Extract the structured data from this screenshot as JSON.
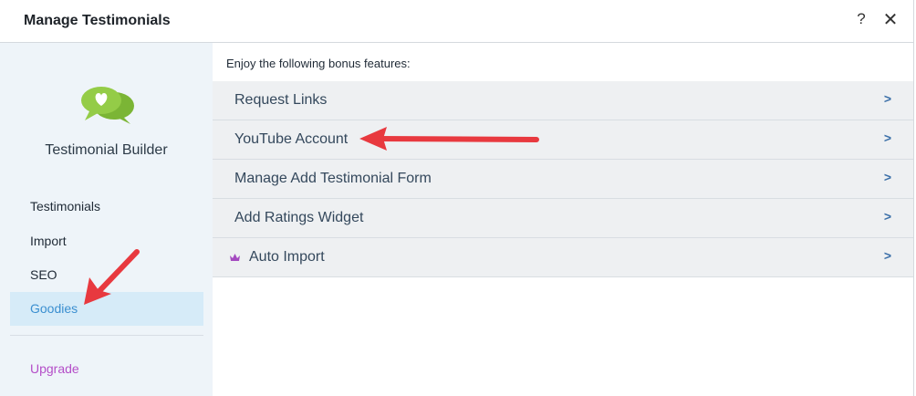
{
  "dialog": {
    "title": "Manage Testimonials",
    "help_label": "?",
    "close_label": "✕"
  },
  "sidebar": {
    "app_name": "Testimonial Builder",
    "items": [
      {
        "label": "Testimonials",
        "active": false
      },
      {
        "label": "Import",
        "active": false
      },
      {
        "label": "SEO",
        "active": false
      },
      {
        "label": "Goodies",
        "active": true
      }
    ],
    "upgrade_label": "Upgrade"
  },
  "main": {
    "intro": "Enjoy the following bonus features:",
    "features": [
      {
        "label": "Request Links",
        "chevron": ">"
      },
      {
        "label": "YouTube Account",
        "chevron": ">"
      },
      {
        "label": "Manage Add Testimonial Form",
        "chevron": ">"
      },
      {
        "label": "Add Ratings Widget",
        "chevron": ">"
      },
      {
        "label": "Auto Import",
        "chevron": ">",
        "icon": "crown-icon"
      }
    ]
  },
  "colors": {
    "sidebar_bg": "#eef4f9",
    "active_bg": "#d6ebf8",
    "active_text": "#3b8fd0",
    "upgrade_text": "#b44ec8",
    "logo_green": "#8cc63f",
    "annotation_arrow": "#e8393f"
  }
}
